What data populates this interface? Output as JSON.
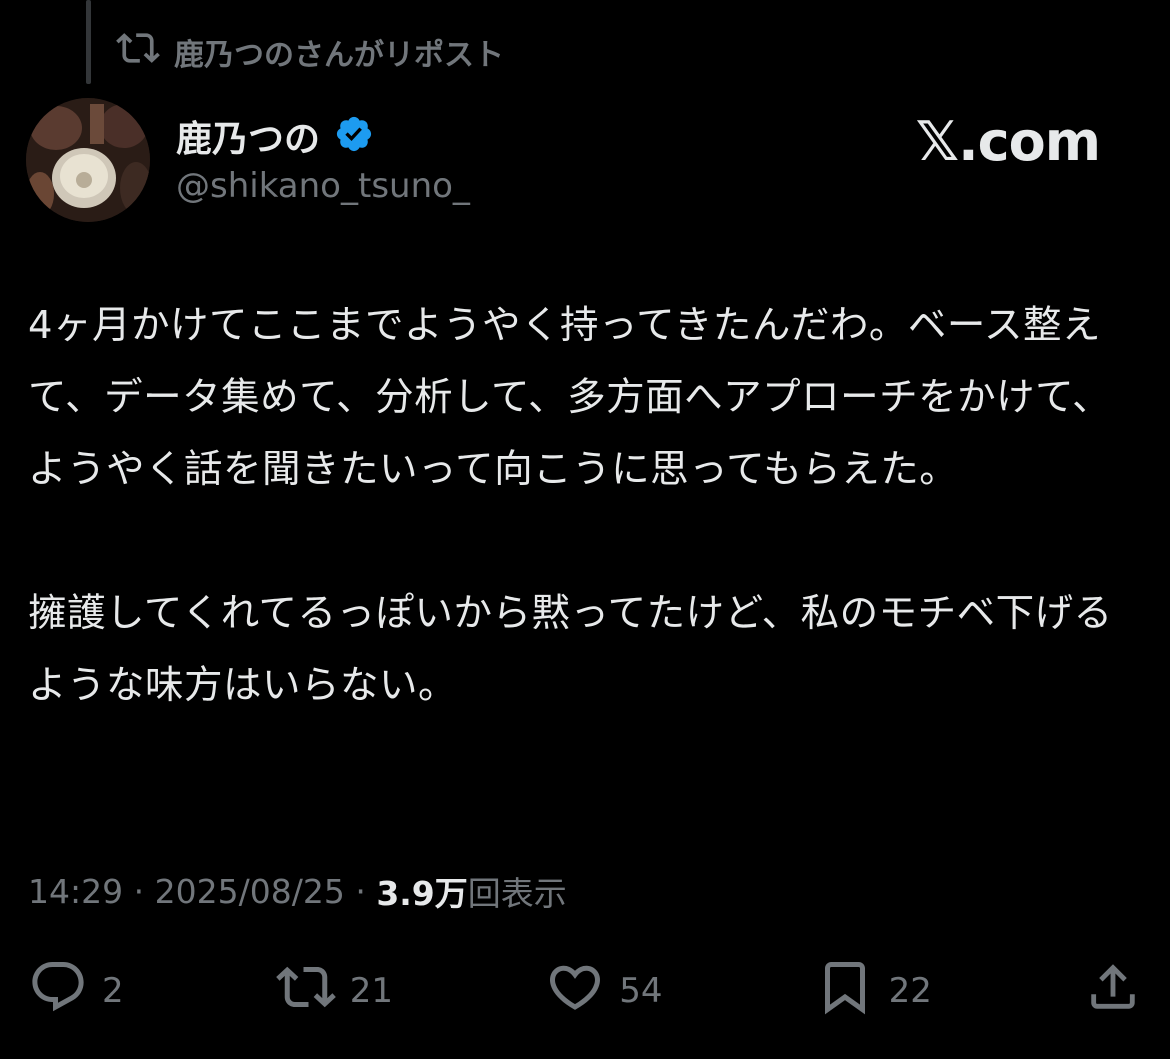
{
  "repost": {
    "text": "鹿乃つのさんがリポスト"
  },
  "author": {
    "display_name": "鹿乃つの",
    "handle": "@shikano_tsuno_",
    "verified": true,
    "verified_color": "#1d9bf0"
  },
  "brand": {
    "label": "𝕏.com"
  },
  "tweet": {
    "body": "4ヶ月かけてここまでようやく持ってきたんだわ。ベース整えて、データ集めて、分析して、多方面へアプローチをかけて、ようやく話を聞きたいって向こうに思ってもらえた。\n\n擁護してくれてるっぽいから黙ってたけど、私のモチベ下げるような味方はいらない。"
  },
  "meta": {
    "time": "14:29",
    "separator": "·",
    "date": "2025/08/25",
    "views_count": "3.9万",
    "views_label": "回表示"
  },
  "actions": {
    "replies": "2",
    "reposts": "21",
    "likes": "54",
    "bookmarks": "22"
  },
  "colors": {
    "background": "#000000",
    "text_primary": "#e7e9ea",
    "text_secondary": "#71767b"
  }
}
